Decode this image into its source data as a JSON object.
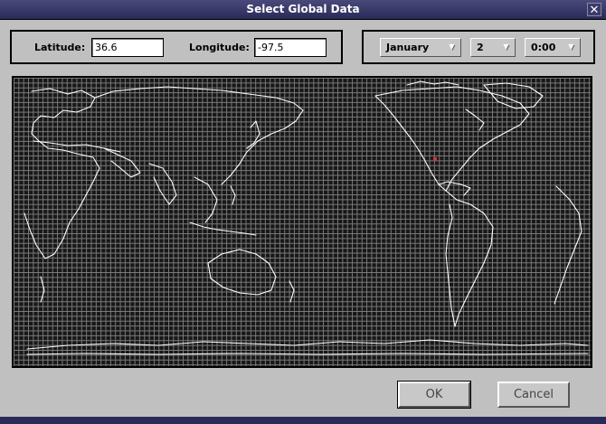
{
  "window": {
    "title": "Select Global Data",
    "close_glyph": "✕"
  },
  "coords": {
    "latitude_label": "Latitude:",
    "latitude_value": "36.6",
    "longitude_label": "Longitude:",
    "longitude_value": "-97.5"
  },
  "date": {
    "month": "January",
    "day": "2",
    "time": "0:00"
  },
  "map": {
    "marker_color": "#e03030",
    "grid_color": "#7a7a7a",
    "coastline_color": "#ffffff"
  },
  "buttons": {
    "ok_label": "OK",
    "cancel_label": "Cancel"
  }
}
